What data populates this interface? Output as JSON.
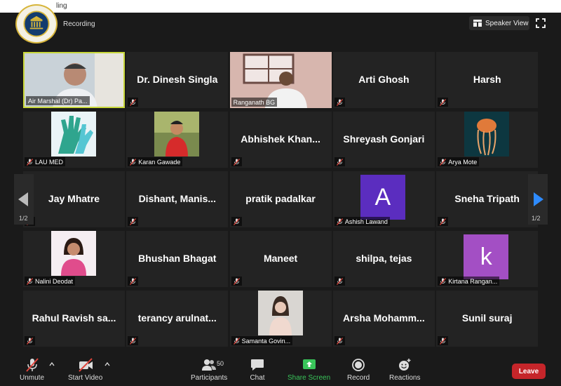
{
  "top": {
    "title_fragment": "ling",
    "recording": "Recording",
    "speaker_view": "Speaker View"
  },
  "participants": [
    {
      "name": "Air Marshal (Dr) Pa...",
      "kind": "video",
      "active": true
    },
    {
      "name": "Dr. Dinesh Singla",
      "kind": "name"
    },
    {
      "name": "Ranganath BG",
      "kind": "video"
    },
    {
      "name": "Arti Ghosh",
      "kind": "name"
    },
    {
      "name": "Harsh",
      "kind": "name"
    },
    {
      "name": "LAU MED",
      "kind": "photo",
      "photo": "gloves"
    },
    {
      "name": "Karan Gawade",
      "kind": "photo",
      "photo": "person"
    },
    {
      "name": "Abhishek  Khan...",
      "kind": "name"
    },
    {
      "name": "Shreyash Gonjari",
      "kind": "name"
    },
    {
      "name": "Arya Mote",
      "kind": "photo",
      "photo": "jellyfish"
    },
    {
      "name": "Jay Mhatre",
      "kind": "name"
    },
    {
      "name": "Dishant,  Manis...",
      "kind": "name"
    },
    {
      "name": "pratik padalkar",
      "kind": "name"
    },
    {
      "name": "Ashish Lawand",
      "kind": "letter",
      "letter": "A",
      "color": "#5b2dbf"
    },
    {
      "name": "Sneha Tripath",
      "kind": "name"
    },
    {
      "name": "Nalini Deodat",
      "kind": "photo",
      "photo": "woman"
    },
    {
      "name": "Bhushan Bhagat",
      "kind": "name"
    },
    {
      "name": "Maneet",
      "kind": "name"
    },
    {
      "name": "shilpa, tejas",
      "kind": "name"
    },
    {
      "name": "Kirtana Rangan...",
      "kind": "letter",
      "letter": "k",
      "color": "#a34fc4"
    },
    {
      "name": "Rahul  Ravish  sa...",
      "kind": "name"
    },
    {
      "name": "terancy  arulnat...",
      "kind": "name"
    },
    {
      "name": "Samanta Govin...",
      "kind": "photo",
      "photo": "lady"
    },
    {
      "name": "Arsha  Mohamm...",
      "kind": "name"
    },
    {
      "name": "Sunil suraj",
      "kind": "name"
    }
  ],
  "pagination": {
    "left": "1/2",
    "right": "1/2"
  },
  "toolbar": {
    "unmute": "Unmute",
    "start_video": "Start Video",
    "participants": "Participants",
    "participants_count": "50",
    "chat": "Chat",
    "share_screen": "Share Screen",
    "record": "Record",
    "reactions": "Reactions",
    "leave": "Leave"
  },
  "colors": {
    "active_border": "#c8d73a",
    "share_green": "#39c55a",
    "leave_red": "#c5252a",
    "tile_bg": "#232323",
    "mute_red": "#e0453c"
  }
}
